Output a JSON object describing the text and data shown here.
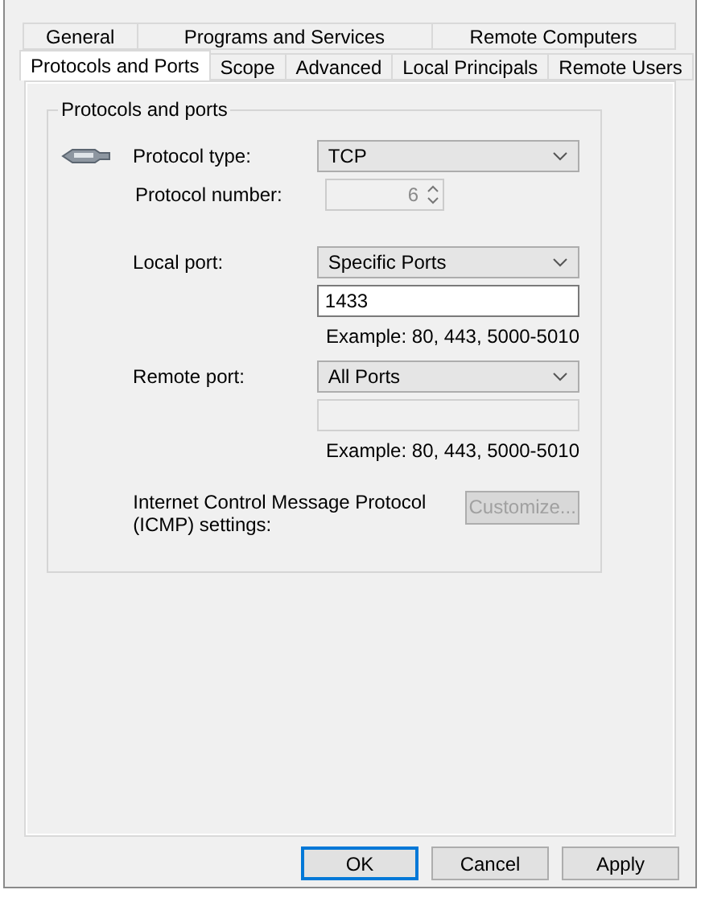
{
  "tabs": [
    [
      {
        "label": "General",
        "selected": false
      },
      {
        "label": "Programs and Services",
        "selected": false
      },
      {
        "label": "Remote Computers",
        "selected": false
      }
    ],
    [
      {
        "label": "Protocols and Ports",
        "selected": true
      },
      {
        "label": "Scope",
        "selected": false
      },
      {
        "label": "Advanced",
        "selected": false
      },
      {
        "label": "Local Principals",
        "selected": false
      },
      {
        "label": "Remote Users",
        "selected": false
      }
    ]
  ],
  "group": {
    "title": "Protocols and ports",
    "protocol_type": {
      "label": "Protocol type:",
      "value": "TCP"
    },
    "protocol_number": {
      "label": "Protocol number:",
      "value": "6",
      "disabled": true
    },
    "local_port": {
      "label": "Local port:",
      "value": "Specific Ports",
      "ports": "1433",
      "ports_disabled": false,
      "example": "Example: 80, 443, 5000-5010"
    },
    "remote_port": {
      "label": "Remote port:",
      "value": "All Ports",
      "ports_disabled": true,
      "example": "Example: 80, 443, 5000-5010"
    },
    "icmp": {
      "label": "Internet Control Message Protocol (ICMP) settings:",
      "button": "Customize...",
      "disabled": true
    }
  },
  "buttons": [
    {
      "label": "OK",
      "default": true
    },
    {
      "label": "Cancel",
      "default": false
    },
    {
      "label": "Apply",
      "default": false
    }
  ]
}
